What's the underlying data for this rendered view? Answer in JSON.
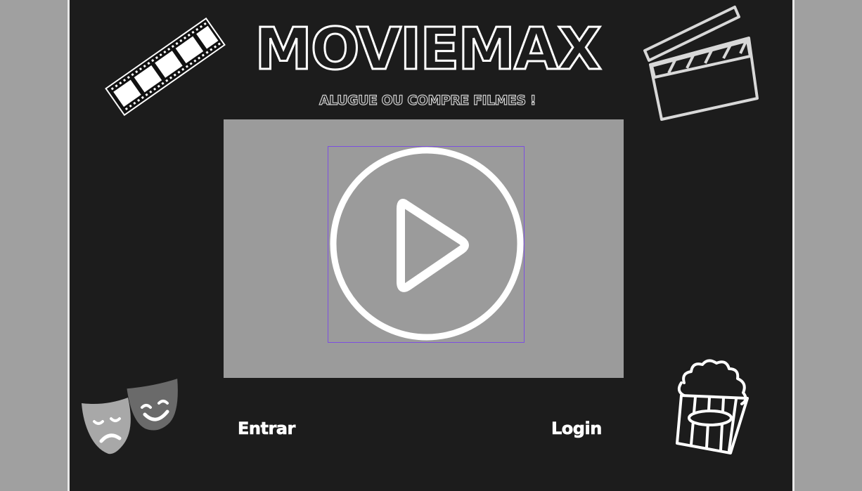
{
  "app": {
    "title": "MOVIEMAX",
    "subtitle": "ALUGUE OU COMPRE FILMES !"
  },
  "player": {
    "icon": "play-icon"
  },
  "nav": {
    "enter_label": "Entrar",
    "login_label": "Login"
  },
  "decor": {
    "icons": [
      "film-strip-icon",
      "clapperboard-icon",
      "theater-masks-icon",
      "popcorn-icon"
    ]
  },
  "colors": {
    "background": "#a0a0a0",
    "panel": "#1c1c1c",
    "video": "#9b9b9b",
    "accent_outline": "#7c4fe0",
    "text": "#ffffff"
  }
}
